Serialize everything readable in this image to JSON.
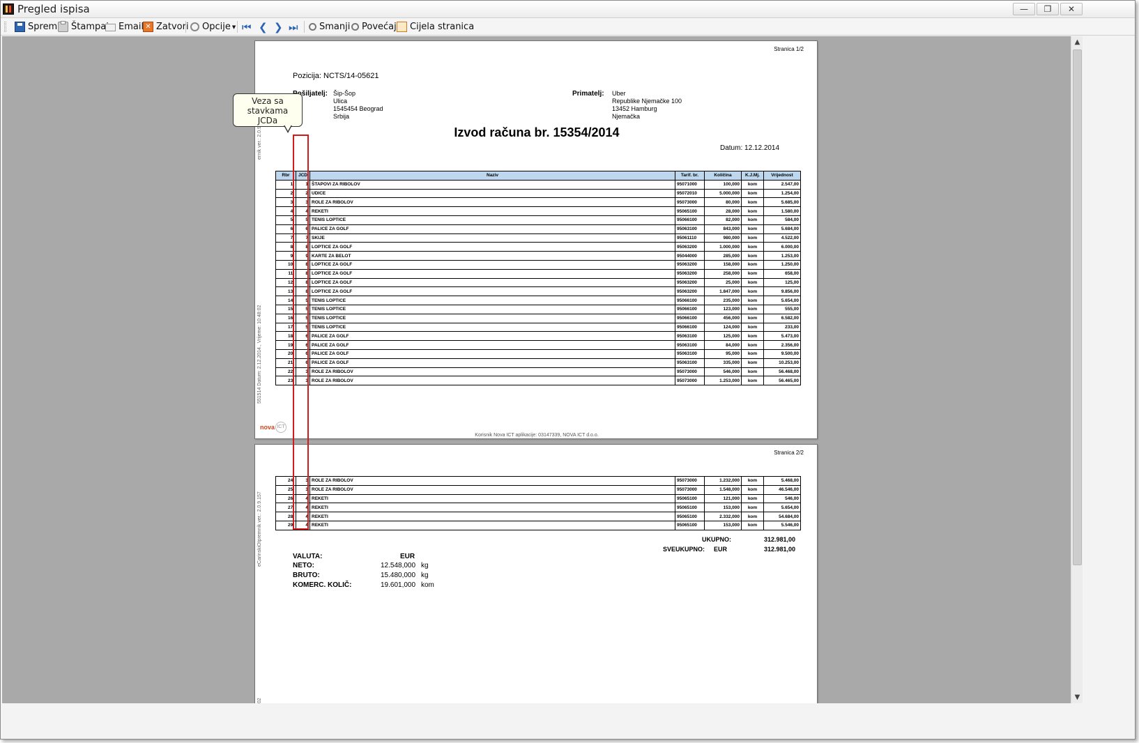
{
  "window": {
    "title": "Pregled ispisa",
    "btn_min": "—",
    "btn_restore": "❐",
    "btn_close": "✕"
  },
  "toolbar": {
    "save": "Spremi",
    "print": "Štampaj",
    "email": "Email",
    "close": "Zatvori",
    "options": "Opcije",
    "zoom_out": "Smanji",
    "zoom_in": "Povećaj",
    "whole_page": "Cijela stranica"
  },
  "callout": {
    "line1": "Veza sa",
    "line2": "stavkama",
    "line3": "JCDa"
  },
  "page1": {
    "page_num": "Stranica 1/2",
    "side_top": "ernik ver.: 2.0.9.157",
    "side_bottom": "551514 Datum: 2.12.2014.,  Vrijeme: 10:48:02",
    "pozicija": "Pozicija: NCTS/14-05621",
    "sender_label": "Pošiljatelj:",
    "sender_lines": [
      "Šip-Šop",
      "Ulica",
      "1545454 Beograd",
      "Srbija"
    ],
    "receiver_label": "Primatelj:",
    "receiver_lines": [
      "Uber",
      "Republike Njemačke 100",
      "13452 Hamburg",
      "Njemačka"
    ],
    "title": "Izvod računa br. 15354/2014",
    "date": "Datum: 12.12.2014",
    "logo_nova": "nova",
    "logo_ict": "ICT",
    "footer": "Korisnik Nova ICT aplikacije: 03147339, NOVA ICT d.o.o."
  },
  "table": {
    "headers": [
      "Rbr",
      "JCD",
      "Naziv",
      "Tarif. br.",
      "Količina",
      "K.J.Mj.",
      "Vrijednost"
    ],
    "rows_p1": [
      [
        "1.",
        "1",
        "ŠTAPOVI ZA RIBOLOV",
        "95071000",
        "100,000",
        "kom",
        "2.547,00"
      ],
      [
        "2.",
        "2",
        "UDICE",
        "95072010",
        "5.000,000",
        "kom",
        "1.254,00"
      ],
      [
        "3.",
        "3",
        "ROLE ZA RIBOLOV",
        "95073000",
        "80,000",
        "kom",
        "5.685,00"
      ],
      [
        "4.",
        "4",
        "REKETI",
        "95065100",
        "28,000",
        "kom",
        "1.580,00"
      ],
      [
        "5.",
        "5",
        "TENIS LOPTICE",
        "95066100",
        "82,000",
        "kom",
        "584,00"
      ],
      [
        "6.",
        "6",
        "PALICE ZA GOLF",
        "95063100",
        "843,000",
        "kom",
        "5.684,00"
      ],
      [
        "7.",
        "7",
        "SKIJE",
        "95061110",
        "980,000",
        "kom",
        "4.522,00"
      ],
      [
        "8.",
        "8",
        "LOPTICE ZA GOLF",
        "95063200",
        "1.000,000",
        "kom",
        "6.000,00"
      ],
      [
        "9.",
        "9",
        "KARTE ZA BELOT",
        "95044000",
        "285,000",
        "kom",
        "1.253,00"
      ],
      [
        "10.",
        "8",
        "LOPTICE ZA GOLF",
        "95063200",
        "158,000",
        "kom",
        "1.250,00"
      ],
      [
        "11.",
        "8",
        "LOPTICE ZA GOLF",
        "95063200",
        "258,000",
        "kom",
        "658,00"
      ],
      [
        "12.",
        "8",
        "LOPTICE ZA GOLF",
        "95063200",
        "25,000",
        "kom",
        "125,00"
      ],
      [
        "13.",
        "8",
        "LOPTICE ZA GOLF",
        "95063200",
        "1.847,000",
        "kom",
        "9.856,00"
      ],
      [
        "14.",
        "5",
        "TENIS LOPTICE",
        "95066100",
        "235,000",
        "kom",
        "5.654,00"
      ],
      [
        "15.",
        "5",
        "TENIS LOPTICE",
        "95066100",
        "123,000",
        "kom",
        "555,00"
      ],
      [
        "16.",
        "5",
        "TENIS LOPTICE",
        "95066100",
        "456,000",
        "kom",
        "6.582,00"
      ],
      [
        "17.",
        "5",
        "TENIS LOPTICE",
        "95066100",
        "124,000",
        "kom",
        "233,00"
      ],
      [
        "18.",
        "6",
        "PALICE ZA GOLF",
        "95063100",
        "125,000",
        "kom",
        "5.473,00"
      ],
      [
        "19.",
        "6",
        "PALICE ZA GOLF",
        "95063100",
        "84,000",
        "kom",
        "2.356,00"
      ],
      [
        "20.",
        "6",
        "PALICE ZA GOLF",
        "95063100",
        "95,000",
        "kom",
        "9.500,00"
      ],
      [
        "21.",
        "6",
        "PALICE ZA GOLF",
        "95063100",
        "335,000",
        "kom",
        "10.253,00"
      ],
      [
        "22.",
        "3",
        "ROLE ZA RIBOLOV",
        "95073000",
        "546,000",
        "kom",
        "56.468,00"
      ],
      [
        "23.",
        "3",
        "ROLE ZA RIBOLOV",
        "95073000",
        "1.253,000",
        "kom",
        "56.465,00"
      ]
    ],
    "rows_p2": [
      [
        "24.",
        "3",
        "ROLE ZA RIBOLOV",
        "95073000",
        "1.232,000",
        "kom",
        "5.468,00"
      ],
      [
        "25.",
        "3",
        "ROLE ZA RIBOLOV",
        "95073000",
        "1.548,000",
        "kom",
        "46.546,00"
      ],
      [
        "26.",
        "4",
        "REKETI",
        "95065100",
        "121,000",
        "kom",
        "546,00"
      ],
      [
        "27.",
        "4",
        "REKETI",
        "95065100",
        "153,000",
        "kom",
        "5.654,00"
      ],
      [
        "28.",
        "4",
        "REKETI",
        "95065100",
        "2.332,000",
        "kom",
        "54.684,00"
      ],
      [
        "29.",
        "4",
        "REKETI",
        "95065100",
        "153,000",
        "kom",
        "5.546,00"
      ]
    ]
  },
  "page2": {
    "page_num": "Stranica 2/2",
    "side_top": "eCarinskiOtpremnik ver.: 2.0.9.157",
    "side_bottom": "302",
    "ukupno_label": "UKUPNO:",
    "ukupno_value": "312.981,00",
    "sveukupno_label": "SVEUKUPNO:",
    "sveukupno_currency": "EUR",
    "sveukupno_value": "312.981,00",
    "summary": [
      {
        "label": "VALUTA:",
        "value": "EUR",
        "unit": ""
      },
      {
        "label": "NETO:",
        "value": "12.548,000",
        "unit": "kg"
      },
      {
        "label": "BRUTO:",
        "value": "15.480,000",
        "unit": "kg"
      },
      {
        "label": "KOMERC. KOLIČ:",
        "value": "19.601,000",
        "unit": "kom"
      }
    ]
  },
  "scroll": {
    "up": "▲",
    "down": "▼"
  }
}
